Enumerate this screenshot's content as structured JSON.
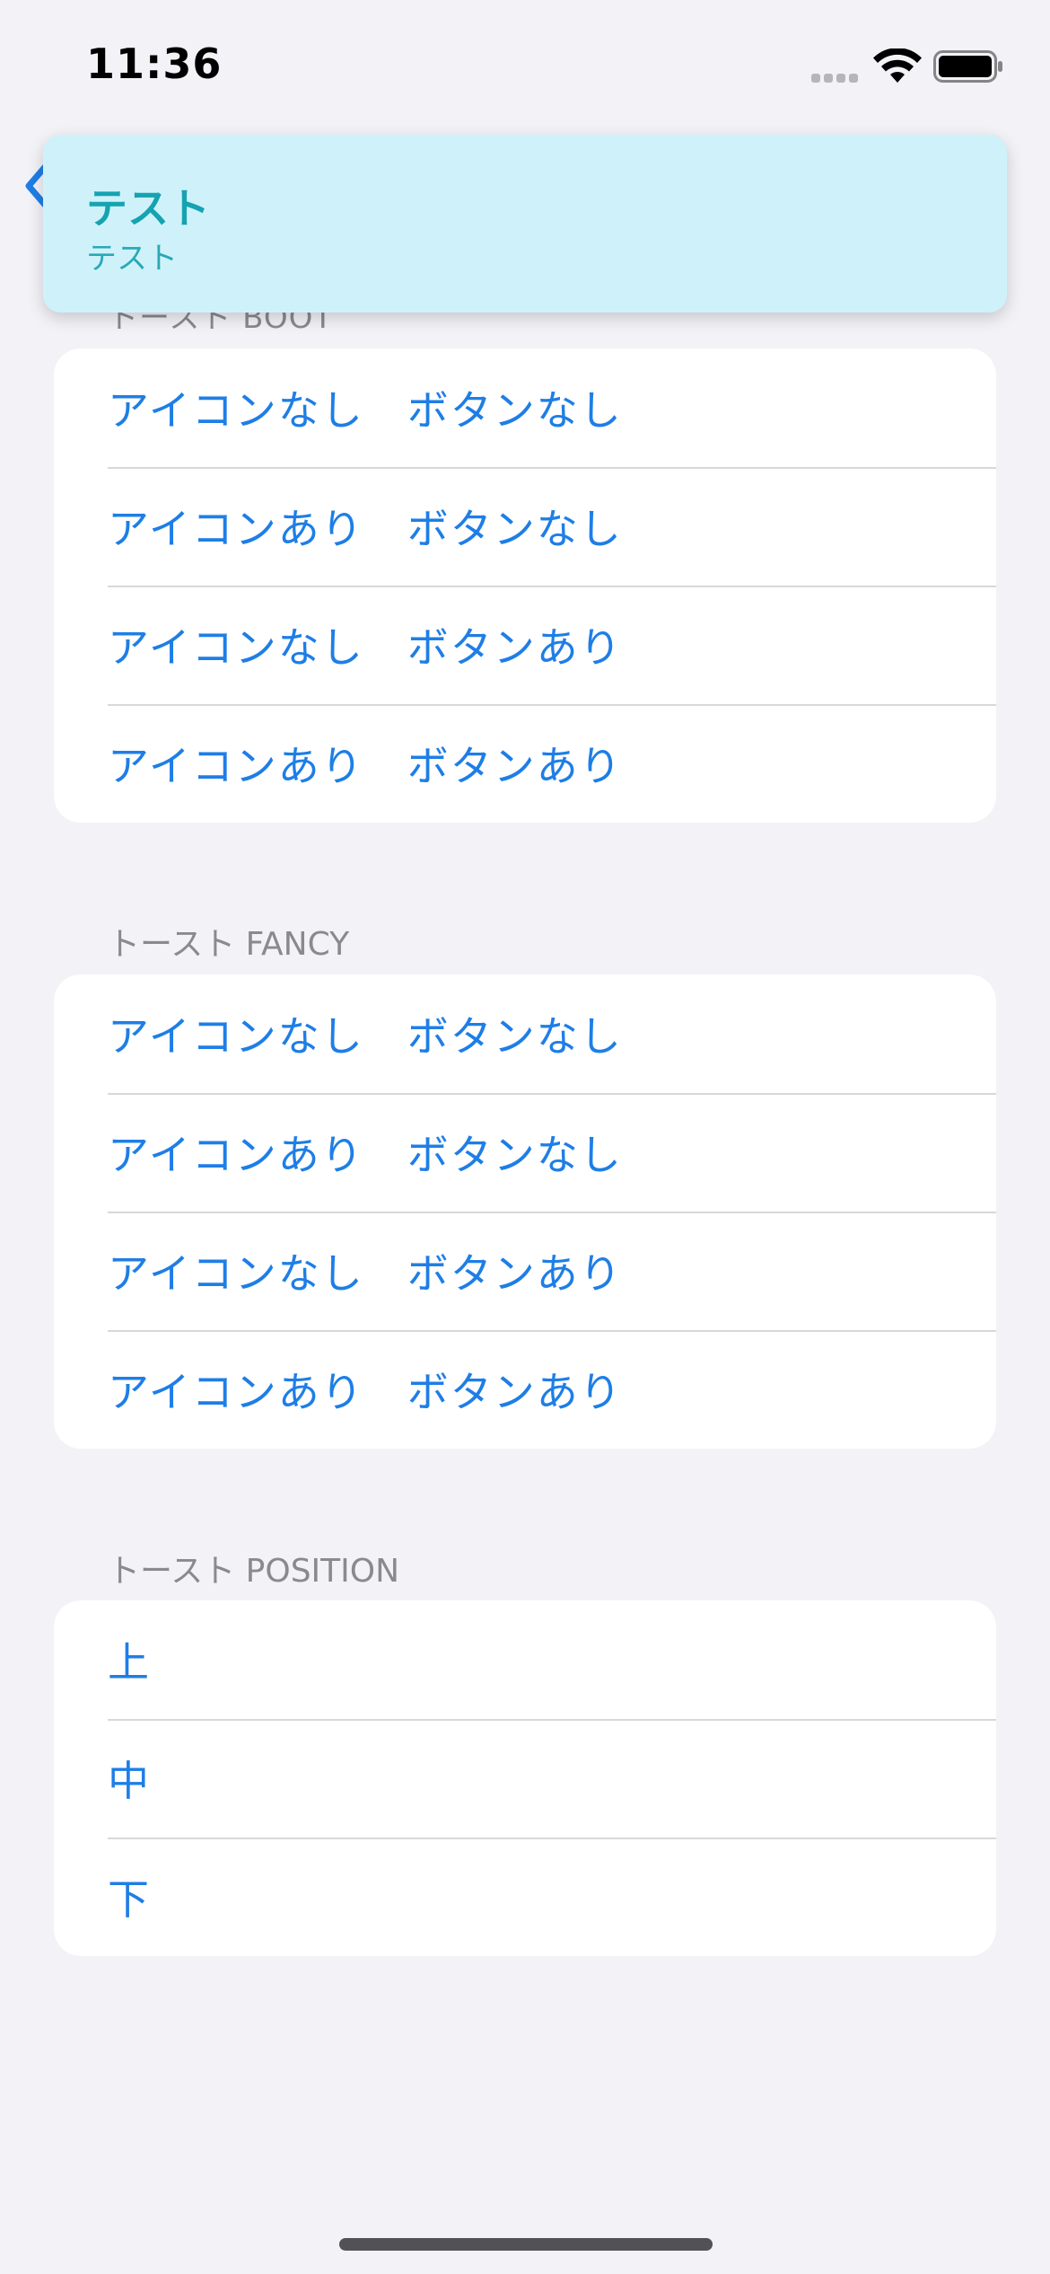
{
  "status_bar": {
    "time": "11:36"
  },
  "toast": {
    "title": "テスト",
    "subtitle": "テスト"
  },
  "sections": [
    {
      "header": "トースト BOOT",
      "rows": [
        "アイコンなし　ボタンなし",
        "アイコンあり　ボタンなし",
        "アイコンなし　ボタンあり",
        "アイコンあり　ボタンあり"
      ]
    },
    {
      "header": "トースト FANCY",
      "rows": [
        "アイコンなし　ボタンなし",
        "アイコンあり　ボタンなし",
        "アイコンなし　ボタンあり",
        "アイコンあり　ボタンあり"
      ]
    },
    {
      "header": "トースト POSITION",
      "rows": [
        "上",
        "中",
        "下"
      ]
    }
  ],
  "colors": {
    "accent": "#1e7ee6",
    "toast_bg": "#cff2fa",
    "toast_text": "#15a3b0",
    "background": "#f2f2f7"
  }
}
